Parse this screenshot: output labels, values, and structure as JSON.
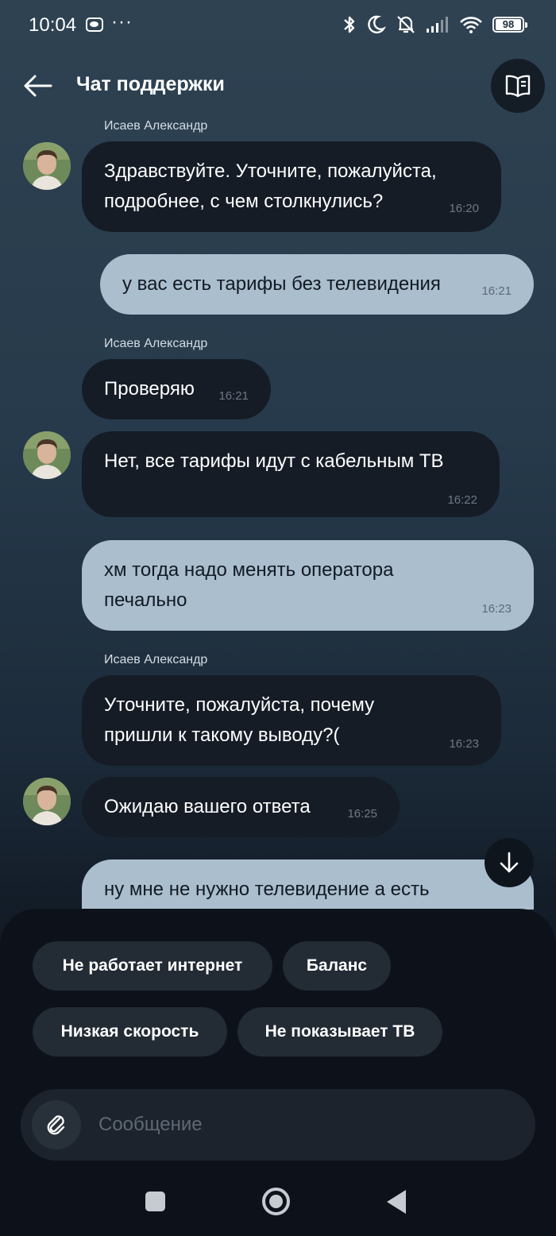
{
  "status": {
    "time": "10:04",
    "more": "···",
    "battery": "98"
  },
  "header": {
    "title": "Чат поддержки"
  },
  "messages": [
    {
      "sender": "Исаев Александр",
      "text": "Здравствуйте. Уточните, пожалуйста,\nподробнее, с чем столкнулись?",
      "time": "16:20"
    },
    {
      "text": "у вас есть тарифы без телевидения",
      "time": "16:21"
    },
    {
      "sender": "Исаев Александр",
      "text": "Проверяю",
      "time": "16:21"
    },
    {
      "text": "Нет, все тарифы идут с кабельным ТВ",
      "time": "16:22"
    },
    {
      "text": "хм тогда надо менять оператора\nпечально",
      "time": "16:23"
    },
    {
      "sender": "Исаев Александр",
      "text": "Уточните, пожалуйста, почему\nпришли к такому выводу?(",
      "time": "16:23"
    },
    {
      "text": "Ожидаю вашего ответа",
      "time": "16:25"
    },
    {
      "text": "ну мне не нужно телевидение а есть"
    }
  ],
  "quick_replies": [
    "Не работает интернет",
    "Баланс",
    "Низкая скорость",
    "Не показывает ТВ"
  ],
  "composer": {
    "placeholder": "Сообщение"
  },
  "colors": {
    "incoming_bubble": "#151c26",
    "outgoing_bubble": "#abbecd",
    "chip": "#232b35",
    "panel": "#0d121a"
  },
  "icons": [
    "back-arrow-icon",
    "book-icon",
    "arrow-down-icon",
    "paperclip-icon",
    "bluetooth-icon",
    "moon-icon",
    "bell-off-icon",
    "signal-icon",
    "wifi-icon",
    "battery-icon"
  ]
}
